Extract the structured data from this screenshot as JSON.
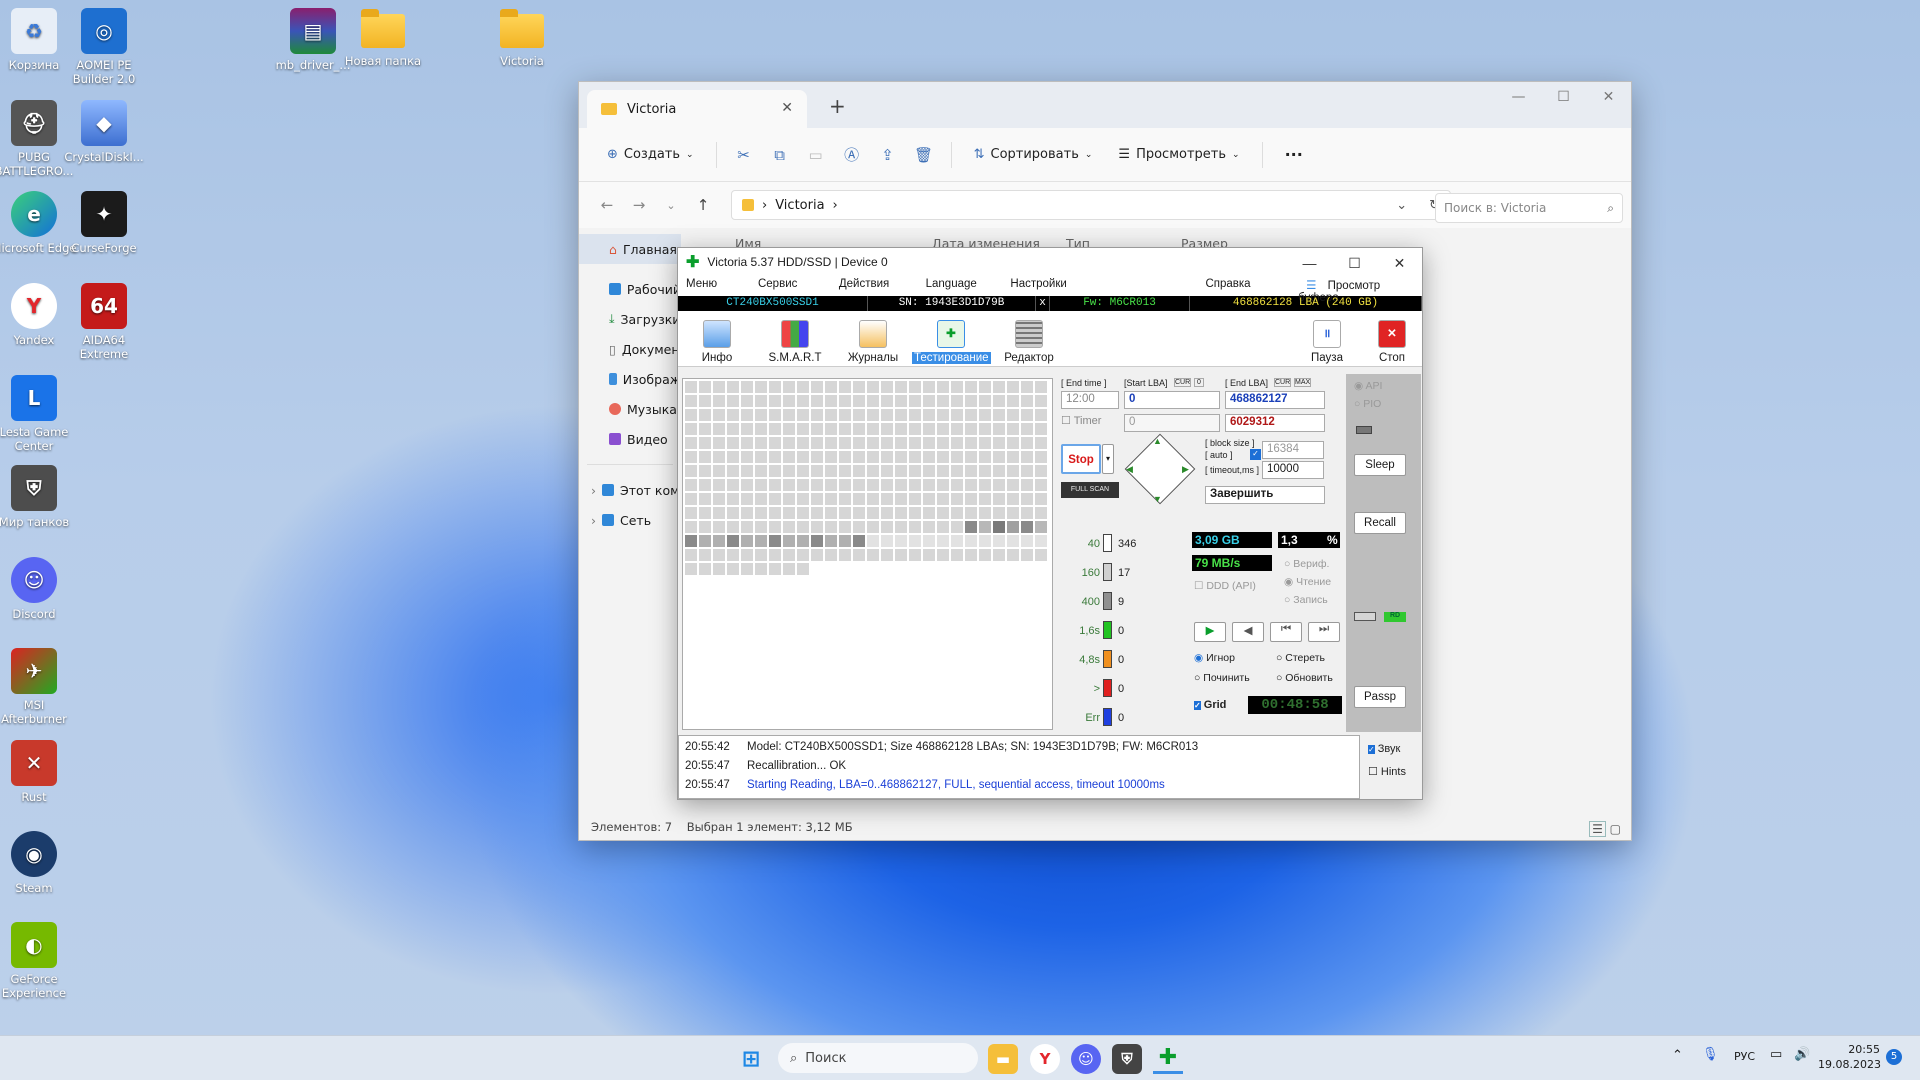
{
  "desktop": {
    "icons": [
      {
        "label": "Корзина",
        "name": "recycle-bin-icon"
      },
      {
        "label": "AOMEI PE Builder 2.0",
        "name": "aomei-icon"
      },
      {
        "label": "mb_driver_...",
        "name": "winrar-archive-icon"
      },
      {
        "label": "Новая папка",
        "name": "folder-icon"
      },
      {
        "label": "Victoria",
        "name": "folder-icon"
      },
      {
        "label": "PUBG BATTLEGRO...",
        "name": "pubg-icon"
      },
      {
        "label": "CrystalDiskI...",
        "name": "crystaldisk-icon"
      },
      {
        "label": "Microsoft Edge",
        "name": "edge-icon"
      },
      {
        "label": "CurseForge",
        "name": "curseforge-icon"
      },
      {
        "label": "Yandex",
        "name": "yandex-icon"
      },
      {
        "label": "AIDA64 Extreme",
        "name": "aida64-icon"
      },
      {
        "label": "Lesta Game Center",
        "name": "lesta-icon"
      },
      {
        "label": "Мир танков",
        "name": "tanks-icon"
      },
      {
        "label": "Discord",
        "name": "discord-icon"
      },
      {
        "label": "MSI Afterburner",
        "name": "afterburner-icon"
      },
      {
        "label": "Rust",
        "name": "rust-icon"
      },
      {
        "label": "Steam",
        "name": "steam-icon"
      },
      {
        "label": "GeForce Experience",
        "name": "geforce-icon"
      }
    ]
  },
  "explorer": {
    "tab": "Victoria",
    "new_tab": "+",
    "toolbar": {
      "create": "Создать",
      "sort": "Сортировать",
      "view": "Просмотреть",
      "more": "···"
    },
    "address": "Victoria",
    "search_placeholder": "Поиск в: Victoria",
    "sidebar": {
      "home": "Главная",
      "items": [
        "Рабочий",
        "Загрузки",
        "Докумен",
        "Изображ",
        "Музыка",
        "Видео"
      ],
      "this_pc": "Этот ком",
      "network": "Сеть"
    },
    "columns": [
      "Имя",
      "Дата изменения",
      "Тип",
      "Размер"
    ],
    "status_count": "Элементов: 7",
    "status_selected": "Выбран 1 элемент: 3,12 МБ"
  },
  "victoria": {
    "title": "Victoria 5.37 HDD/SSD | Device 0",
    "menu": [
      "Меню",
      "Сервис",
      "Действия",
      "Language",
      "Настройки",
      "Справка"
    ],
    "buffer": "Просмотр буфера",
    "info": {
      "model": "CT240BX500SSD1",
      "sn": "SN: 1943E3D1D79B",
      "x": "x",
      "fw": "Fw: M6CR013",
      "lba": "468862128 LBA (240 GB)"
    },
    "tools": [
      "Инфо",
      "S.M.A.R.T",
      "Журналы",
      "Тестирование",
      "Редактор"
    ],
    "pause": "Пауза",
    "stop_top": "Стоп",
    "end_time_lbl": "[ End time ]",
    "start_lba_lbl": "[Start LBA]",
    "cur": "CUR",
    "zero": "0",
    "end_lba_lbl": "[ End LBA]",
    "max": "MAX",
    "time_val": "12:00",
    "start_lba": "0",
    "end_lba": "468862127",
    "timer_lbl": "Timer",
    "timer_val": "0",
    "cur_lba": "6029312",
    "stop_btn": "Stop",
    "full_scan": "FULL SCAN",
    "block_lbl": "[ block size ]",
    "auto_lbl": "[ auto ]",
    "timeout_lbl": "[ timeout,ms ]",
    "block_val": "16384",
    "timeout_val": "10000",
    "finish": "Завершить",
    "api": "API",
    "pio": "PIO",
    "sleep": "Sleep",
    "recall": "Recall",
    "passp": "Passp",
    "rd": "RD",
    "counters": [
      {
        "t": "40",
        "v": "346",
        "c": "#ffffff"
      },
      {
        "t": "160",
        "v": "17",
        "c": "#d0d0d0"
      },
      {
        "t": "400",
        "v": "9",
        "c": "#909090"
      },
      {
        "t": "1,6s",
        "v": "0",
        "c": "#22c322"
      },
      {
        "t": "4,8s",
        "v": "0",
        "c": "#f09020"
      },
      {
        "t": ">",
        "v": "0",
        "c": "#e02020"
      },
      {
        "t": "Err",
        "v": "0",
        "c": "#2040e0"
      }
    ],
    "gb": "3,09 GB",
    "pct": "1,3",
    "pct_sign": "%",
    "speed": "79 MB/s",
    "verify": "Вериф.",
    "read": "Чтение",
    "write": "Запись",
    "ddd": "DDD (API)",
    "ignore": "Игнор",
    "erase": "Стереть",
    "repair": "Починить",
    "refresh": "Обновить",
    "grid_lbl": "Grid",
    "clock": "00:48:58",
    "sound": "Звук",
    "hints": "Hints",
    "log": [
      {
        "t": "20:55:42",
        "m": "Model: CT240BX500SSD1; Size 468862128 LBAs; SN: 1943E3D1D79B; FW: M6CR013",
        "c": "#222"
      },
      {
        "t": "20:55:47",
        "m": "Recallibration... OK",
        "c": "#222"
      },
      {
        "t": "20:55:47",
        "m": "Starting Reading, LBA=0..468862127, FULL, sequential access, timeout 10000ms",
        "c": "#1a3fd6"
      }
    ]
  },
  "taskbar": {
    "search": "Поиск",
    "lang": "РУС",
    "time": "20:55",
    "date": "19.08.2023",
    "badge": "5"
  },
  "colors": {
    "accent": "#3a8ee6",
    "green": "#0a9e2c",
    "lcd_cyan": "#39d0e8",
    "lcd_green": "#48e048"
  }
}
